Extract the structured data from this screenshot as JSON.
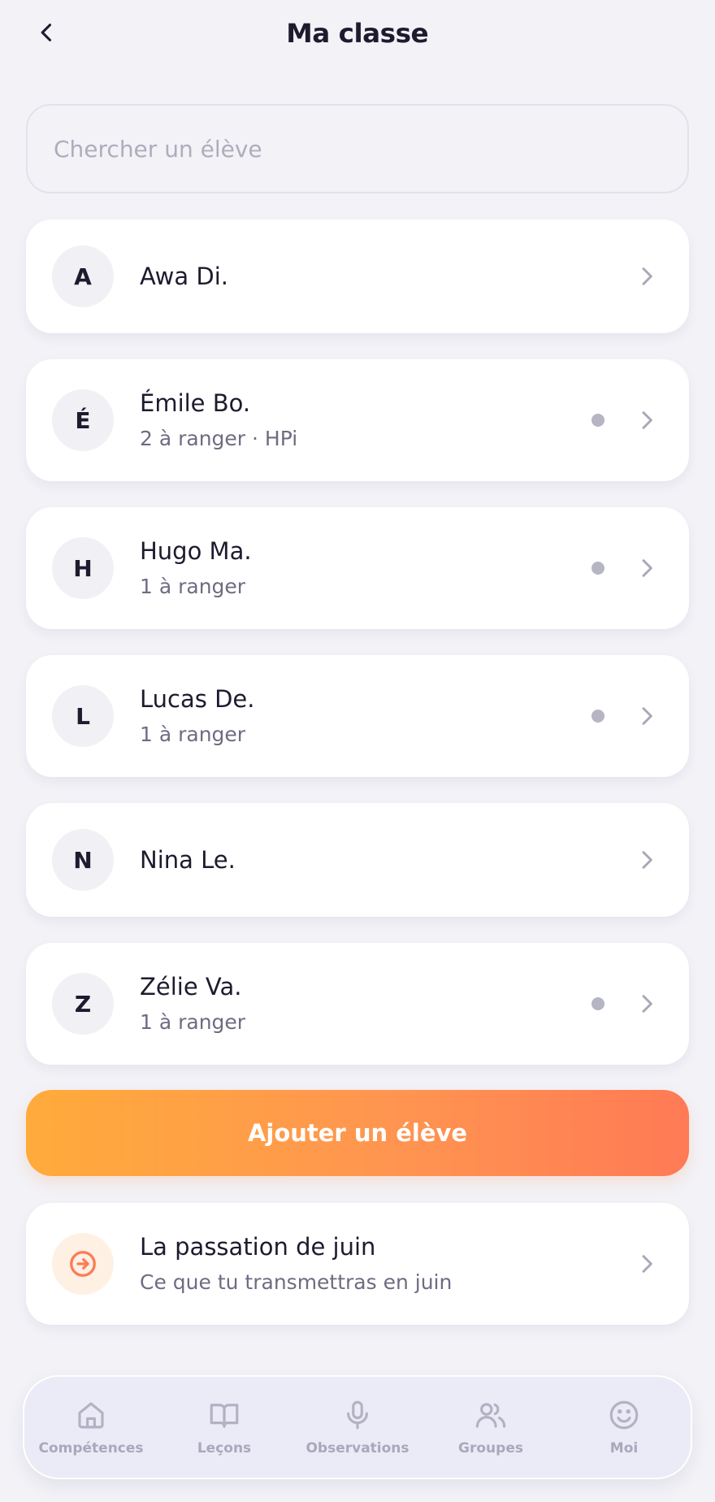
{
  "header": {
    "title": "Ma classe"
  },
  "search": {
    "placeholder": "Chercher un élève",
    "value": ""
  },
  "students": [
    {
      "initial": "A",
      "name": "Awa Di.",
      "sub": "",
      "pending": false
    },
    {
      "initial": "É",
      "name": "Émile Bo.",
      "sub": "2 à ranger · HPi",
      "pending": true
    },
    {
      "initial": "H",
      "name": "Hugo Ma.",
      "sub": "1 à ranger",
      "pending": true
    },
    {
      "initial": "L",
      "name": "Lucas De.",
      "sub": "1 à ranger",
      "pending": true
    },
    {
      "initial": "N",
      "name": "Nina Le.",
      "sub": "",
      "pending": false
    },
    {
      "initial": "Z",
      "name": "Zélie Va.",
      "sub": "1 à ranger",
      "pending": true
    }
  ],
  "add_button": {
    "label": "Ajouter un élève"
  },
  "handoff": {
    "title": "La passation de juin",
    "subtitle": "Ce que tu transmettras en juin",
    "icon": "arrow-right-circle-icon"
  },
  "tabbar": [
    {
      "label": "Compétences",
      "icon": "home-icon"
    },
    {
      "label": "Leçons",
      "icon": "book-icon"
    },
    {
      "label": "Observations",
      "icon": "microphone-icon"
    },
    {
      "label": "Groupes",
      "icon": "users-icon"
    },
    {
      "label": "Moi",
      "icon": "smiley-icon"
    }
  ],
  "colors": {
    "background": "#f2f2f7",
    "accent_start": "#ffab3b",
    "accent_end": "#ff7a55",
    "text_primary": "#1d1b2e",
    "text_secondary": "#6e6c82",
    "tab_inactive": "#a9a8bb"
  }
}
